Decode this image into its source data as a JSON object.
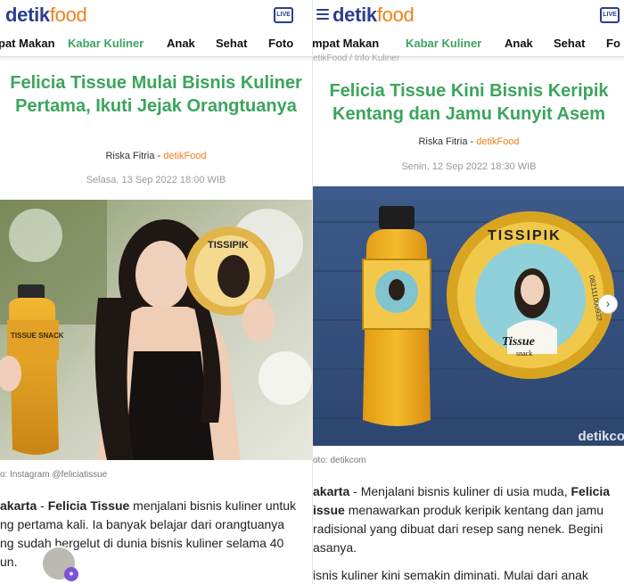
{
  "left": {
    "brand": {
      "detik": "detik",
      "food": "food"
    },
    "live_label": "LIVE",
    "nav": [
      {
        "label": "pat Makan",
        "active": false
      },
      {
        "label": "Kabar Kuliner",
        "active": true
      },
      {
        "label": "Anak",
        "active": false
      },
      {
        "label": "Sehat",
        "active": false
      },
      {
        "label": "Foto",
        "active": false
      }
    ],
    "headline": "Felicia Tissue Mulai Bisnis Kuliner Pertama, Ikuti Jejak Orangtuanya",
    "author": "Riska Fitria",
    "separator": " - ",
    "source": "detikFood",
    "date": "Selasa, 13 Sep 2022 18:00 WIB",
    "caption": "o: Instagram @feliciatissue",
    "body": {
      "place": "akarta",
      "dash": " - ",
      "name": "Felicia Tissue",
      "text_1": " menjalani bisnis kuliner untuk",
      "line_2": "ng pertama kali. Ia banyak belajar dari orangtuanya",
      "line_3": "ng sudah bergelut di dunia bisnis kuliner selama 40",
      "line_4": "un."
    },
    "product_labels": {
      "jar": "TISSIPIK",
      "bottle": "TISSUE SNACK"
    }
  },
  "right": {
    "brand": {
      "detik": "detik",
      "food": "food"
    },
    "live_label": "LIVE",
    "nav": [
      {
        "label": "mpat Makan",
        "active": false
      },
      {
        "label": "Kabar Kuliner",
        "active": true
      },
      {
        "label": "Anak",
        "active": false
      },
      {
        "label": "Sehat",
        "active": false
      },
      {
        "label": "Fo",
        "active": false
      }
    ],
    "breadcrumb": "etikFood / Info Kuliner",
    "headline": "Felicia Tissue Kini Bisnis Keripik Kentang dan Jamu Kunyit Asem",
    "author": "Riska Fitria",
    "separator": " - ",
    "source": "detikFood",
    "date": "Senin, 12 Sep 2022 18:30 WIB",
    "caption": "oto: detikcom",
    "watermark": "detikco",
    "body": {
      "place": "akarta",
      "dash": " - Menjalani bisnis kuliner di usia muda, ",
      "name_1": "Felicia",
      "name_2": "issue",
      "line_2_rest": " menawarkan produk keripik kentang dan jamu",
      "line_3": "radisional yang dibuat dari resep sang nenek. Begini",
      "line_4": "asanya.",
      "para_2": "isnis kuliner kini semakin diminati. Mulai dari anak"
    },
    "product_labels": {
      "jar": "TISSIPIK",
      "jar_script": "Tissue",
      "jar_script_sub": "snack",
      "jar_phone": "082111000932"
    }
  },
  "colors": {
    "brand_blue": "#2b3e8e",
    "brand_orange": "#ef7f1a",
    "headline_green": "#3ba55c",
    "jamu_yellow": "#e6a21a"
  }
}
